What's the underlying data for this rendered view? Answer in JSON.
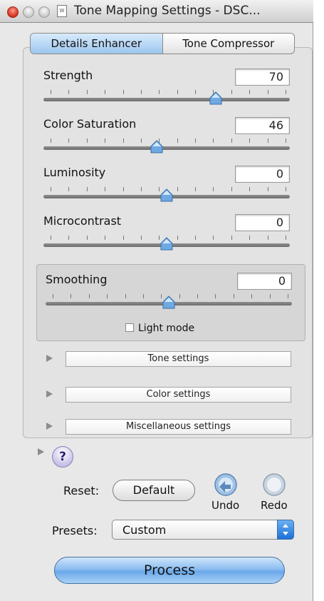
{
  "window": {
    "title": "Tone Mapping Settings - DSC...",
    "doc_icon_glyph": "W"
  },
  "tabs": [
    {
      "label": "Details Enhancer",
      "active": true
    },
    {
      "label": "Tone Compressor",
      "active": false
    }
  ],
  "sliders": [
    {
      "label": "Strength",
      "value": "70",
      "position": 0.7
    },
    {
      "label": "Color Saturation",
      "value": "46",
      "position": 0.46
    },
    {
      "label": "Luminosity",
      "value": "0",
      "position": 0.5
    },
    {
      "label": "Microcontrast",
      "value": "0",
      "position": 0.5
    }
  ],
  "smoothing": {
    "label": "Smoothing",
    "value": "0",
    "position": 0.5,
    "light_mode_label": "Light mode",
    "light_mode_checked": false
  },
  "sections": [
    {
      "label": "Tone settings"
    },
    {
      "label": "Color settings"
    },
    {
      "label": "Miscellaneous settings"
    }
  ],
  "help_label": "?",
  "reset": {
    "label": "Reset:",
    "default_button": "Default",
    "undo_label": "Undo",
    "redo_label": "Redo"
  },
  "presets": {
    "label": "Presets:",
    "value": "Custom"
  },
  "process_button": "Process",
  "colors": {
    "accent": "#6aa8ea",
    "tab_active": "#9cc6ef",
    "close_button": "#d0301c"
  }
}
